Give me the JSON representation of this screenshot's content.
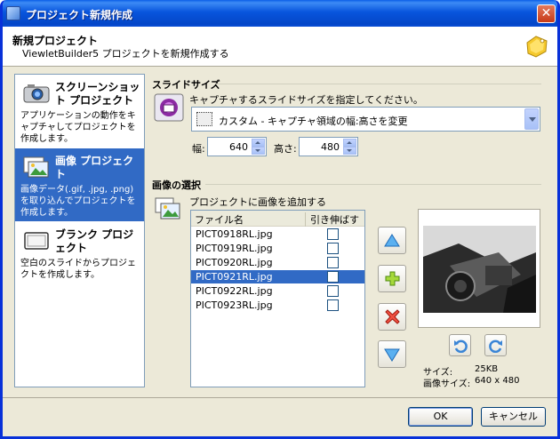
{
  "window": {
    "title": "プロジェクト新規作成",
    "close_label": "✕"
  },
  "header": {
    "title": "新規プロジェクト",
    "subtitle": "ViewletBuilder5 プロジェクトを新規作成する"
  },
  "sidebar": {
    "items": [
      {
        "title": "スクリーンショット プロジェクト",
        "desc": "アプリケーションの動作をキャプチャしてプロジェクトを作成します。",
        "icon": "camera-icon",
        "selected": false
      },
      {
        "title": "画像 プロジェクト",
        "desc": "画像データ(.gif, .jpg, .png)を取り込んでプロジェクトを作成します。",
        "icon": "image-icon",
        "selected": true
      },
      {
        "title": "ブランク プロジェクト",
        "desc": "空白のスライドからプロジェクトを作成します。",
        "icon": "blank-slide-icon",
        "selected": false
      }
    ]
  },
  "slide_size": {
    "section_label": "スライドサイズ",
    "prompt": "キャプチャするスライドサイズを指定してください。",
    "combo_value": "カスタム - キャプチャ領域の幅:高さを変更",
    "width_label": "幅:",
    "width_value": "640",
    "height_label": "高さ:",
    "height_value": "480"
  },
  "image_select": {
    "section_label": "画像の選択",
    "prompt": "プロジェクトに画像を追加する",
    "columns": [
      "ファイル名",
      "引き伸ばす"
    ],
    "files": [
      {
        "name": "PICT0918RL.jpg",
        "stretch": false,
        "selected": false
      },
      {
        "name": "PICT0919RL.jpg",
        "stretch": false,
        "selected": false
      },
      {
        "name": "PICT0920RL.jpg",
        "stretch": false,
        "selected": false
      },
      {
        "name": "PICT0921RL.jpg",
        "stretch": false,
        "selected": true
      },
      {
        "name": "PICT0922RL.jpg",
        "stretch": false,
        "selected": false
      },
      {
        "name": "PICT0923RL.jpg",
        "stretch": false,
        "selected": false
      }
    ]
  },
  "preview": {
    "size_label": "サイズ:",
    "size_value": "25KB",
    "dims_label": "画像サイズ:",
    "dims_value": "640 x 480"
  },
  "footer": {
    "ok_label": "OK",
    "cancel_label": "キャンセル"
  },
  "colors": {
    "selection": "#316ac5",
    "titlebar": "#0855dd"
  }
}
